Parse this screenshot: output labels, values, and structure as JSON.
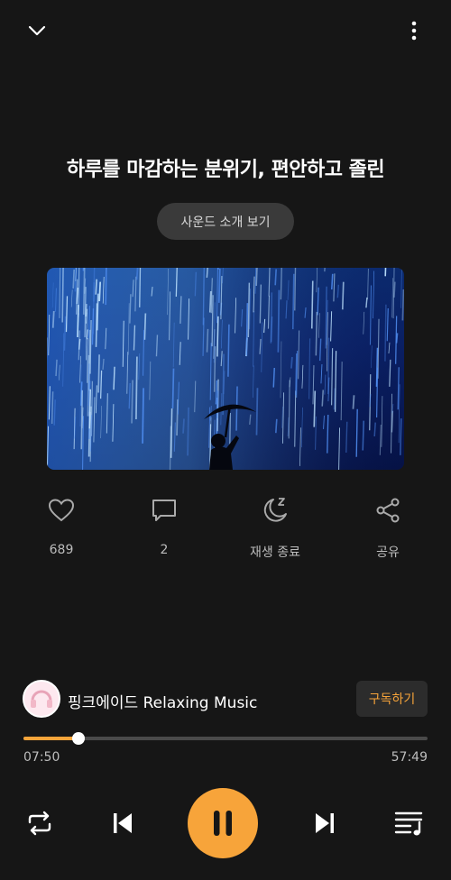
{
  "header": {
    "collapse_icon": "chevron-down-icon",
    "menu_icon": "more-vertical-icon"
  },
  "title": "하루를 마감하는 분위기, 편안하고 졸린",
  "intro_button": "사운드 소개 보기",
  "artwork": {
    "description_icon": "rain-umbrella-artwork"
  },
  "actions": [
    {
      "icon": "heart-icon",
      "label": "689"
    },
    {
      "icon": "comment-icon",
      "label": "2"
    },
    {
      "icon": "sleep-timer-icon",
      "label": "재생 종료"
    },
    {
      "icon": "share-icon",
      "label": "공유"
    }
  ],
  "channel": {
    "name": "핑크에이드 Relaxing Music",
    "subscribe_label": "구독하기"
  },
  "progress": {
    "current": "07:50",
    "total": "57:49",
    "fraction": 0.136
  },
  "controls": {
    "repeat_icon": "repeat-icon",
    "prev_icon": "skip-previous-icon",
    "play_icon": "pause-icon",
    "next_icon": "skip-next-icon",
    "queue_icon": "playlist-icon"
  },
  "colors": {
    "accent": "#f7a43a",
    "background": "#161616"
  }
}
